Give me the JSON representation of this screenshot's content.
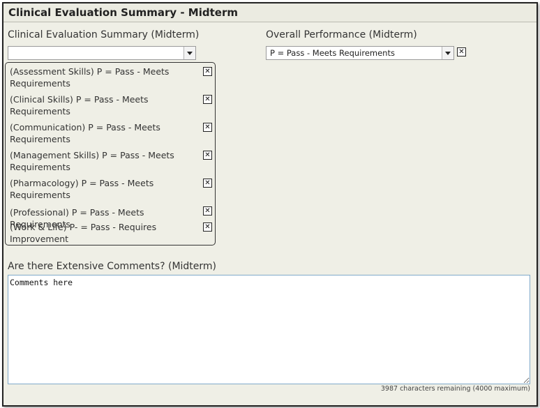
{
  "panel": {
    "title": "Clinical Evaluation Summary - Midterm"
  },
  "summary": {
    "label": "Clinical Evaluation Summary (Midterm)",
    "select_value": "",
    "items": [
      "(Assessment Skills) P = Pass - Meets Requirements",
      "(Clinical Skills) P = Pass - Meets Requirements",
      "(Communication) P = Pass - Meets Requirements",
      "(Management Skills) P = Pass - Meets Requirements",
      "(Pharmacology) P = Pass - Meets Requirements",
      "(Professional) P = Pass - Meets Requirements",
      "(Work & Life) P- = Pass - Requires Improvement"
    ],
    "remove_glyph": "✕"
  },
  "overall": {
    "label": "Overall Performance (Midterm)",
    "select_value": "P = Pass - Meets Requirements",
    "remove_glyph": "✕"
  },
  "comments": {
    "label": "Are there Extensive Comments? (Midterm)",
    "value": "Comments here",
    "counter": "3987 characters remaining (4000 maximum)"
  }
}
